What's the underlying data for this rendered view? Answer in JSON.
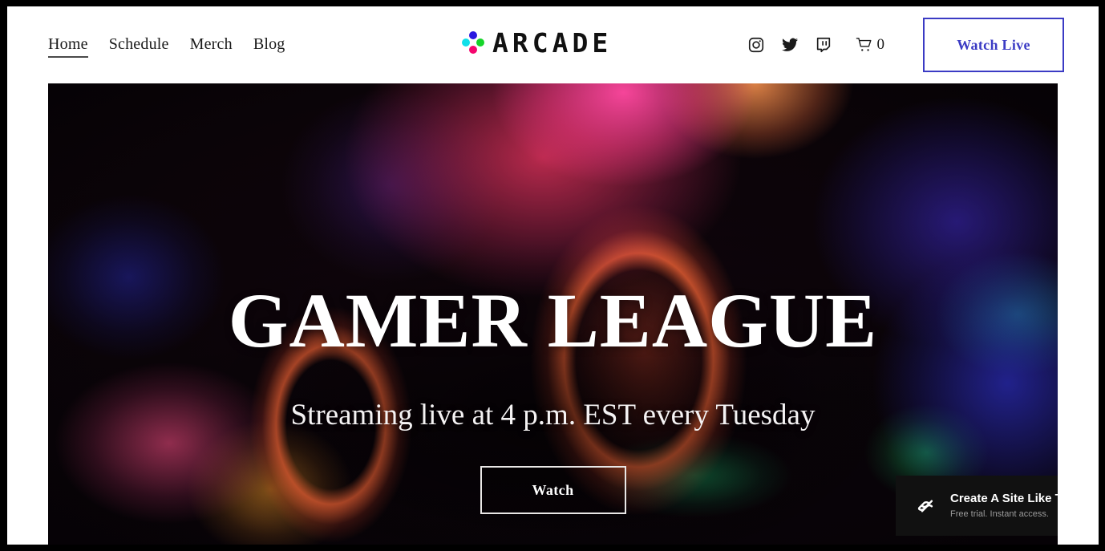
{
  "header": {
    "nav": [
      {
        "label": "Home",
        "active": true
      },
      {
        "label": "Schedule",
        "active": false
      },
      {
        "label": "Merch",
        "active": false
      },
      {
        "label": "Blog",
        "active": false
      }
    ],
    "logo": {
      "wordmark": "ARCADE",
      "mark_icon": "four-dot-diamond-icon",
      "dot_colors": {
        "top": "#2a18e0",
        "left": "#11e0ea",
        "right": "#16d52a",
        "bottom": "#f5066e"
      }
    },
    "social": [
      {
        "name": "instagram-icon",
        "label": "Instagram"
      },
      {
        "name": "twitter-icon",
        "label": "Twitter"
      },
      {
        "name": "twitch-icon",
        "label": "Twitch"
      }
    ],
    "cart": {
      "icon": "shopping-cart-icon",
      "count": "0"
    },
    "cta": {
      "label": "Watch Live",
      "accent_color": "#3b3bc4"
    }
  },
  "hero": {
    "title": "GAMER LEAGUE",
    "subtitle": "Streaming live at 4 p.m. EST every Tuesday",
    "button_label": "Watch",
    "background": "abstract-bokeh-lights-image"
  },
  "promo_badge": {
    "icon": "squarespace-logo-icon",
    "title": "Create A Site Like This",
    "subtitle": "Free trial. Instant access.",
    "background_color": "#111111"
  }
}
